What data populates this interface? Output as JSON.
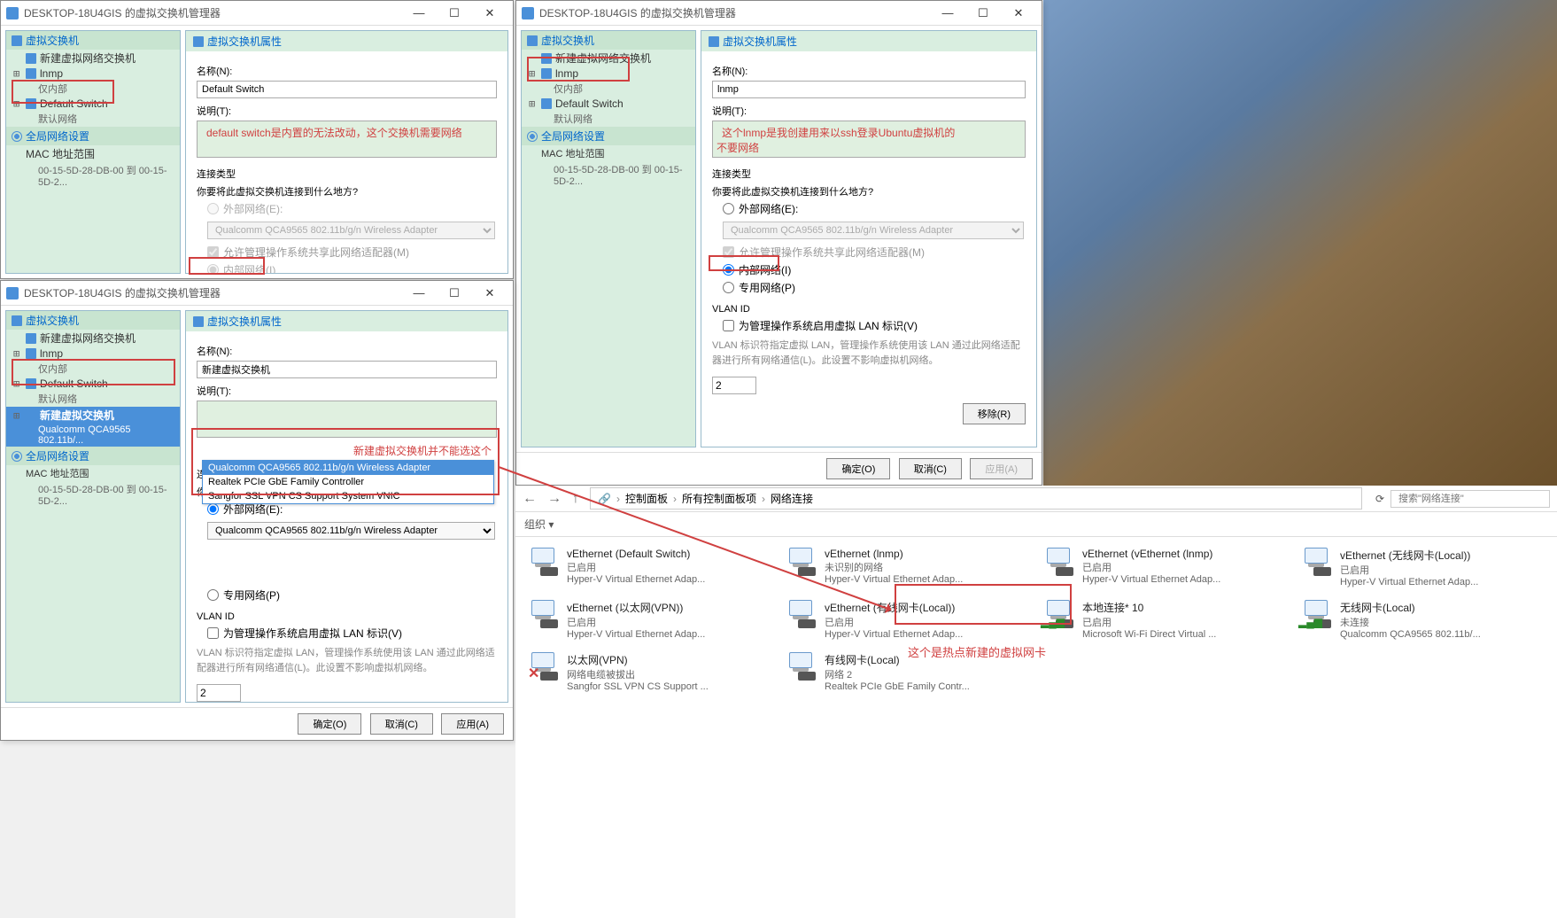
{
  "window_title": "DESKTOP-18U4GIS 的虚拟交换机管理器",
  "tree": {
    "vswitch_header": "虚拟交换机",
    "new_switch": "新建虚拟网络交换机",
    "lnmp": "lnmp",
    "internal_only": "仅内部",
    "default_switch": "Default Switch",
    "default_network": "默认网络",
    "new_vswitch": "新建虚拟交换机",
    "qualcomm_switch": "Qualcomm QCA9565 802.11b/...",
    "global_header": "全局网络设置",
    "mac_range": "MAC 地址范围",
    "mac_value": "00-15-5D-28-DB-00 到 00-15-5D-2..."
  },
  "panels": {
    "header": "虚拟交换机属性",
    "name_label": "名称(N):",
    "desc_label": "说明(T):",
    "conn_title": "连接类型",
    "conn_ask": "你要将此虚拟交换机连接到什么地方?",
    "ext_net": "外部网络(E):",
    "int_net": "内部网络(I)",
    "pri_net": "专用网络(P)",
    "adapter": "Qualcomm QCA9565 802.11b/g/n Wireless Adapter",
    "allow_mgmt": "允许管理操作系统共享此网络适配器(M)",
    "vlan_title": "VLAN ID",
    "vlan_chk": "为管理操作系统启用虚拟 LAN 标识(V)",
    "vlan_hint": "VLAN 标识符指定虚拟 LAN，管理操作系统使用该 LAN 通过此网络适配器进行所有网络通信(L)。此设置不影响虚拟机网络。",
    "vlan_value": "2",
    "remove": "移除(R)",
    "ok": "确定(O)",
    "cancel": "取消(C)",
    "apply": "应用(A)"
  },
  "win1": {
    "name_value": "Default Switch",
    "annotation": "default switch是内置的无法改动，这个交换机需要网络"
  },
  "win2": {
    "name_value": "lnmp",
    "annotation": "这个lnmp是我创建用来以ssh登录Ubuntu虚拟机的\n不要网络"
  },
  "win3": {
    "name_value": "新建虚拟交换机",
    "annotation_top": "新建虚拟交换机并不能选这个",
    "dropdown": {
      "opt0": "Qualcomm QCA9565 802.11b/g/n Wireless Adapter",
      "opt1": "Qualcomm QCA9565 802.11b/g/n Wireless Adapter",
      "opt2": "Realtek PCIe GbE Family Controller",
      "opt3": "Sangfor SSL VPN CS Support System VNIC"
    }
  },
  "explorer": {
    "crumb1": "控制面板",
    "crumb2": "所有控制面板项",
    "crumb3": "网络连接",
    "search_ph": "搜索\"网络连接\"",
    "organize": "组织 ▾",
    "items": [
      {
        "name": "vEthernet (Default Switch)",
        "status": "已启用",
        "desc": "Hyper-V Virtual Ethernet Adap..."
      },
      {
        "name": "vEthernet (lnmp)",
        "status": "未识别的网络",
        "desc": "Hyper-V Virtual Ethernet Adap..."
      },
      {
        "name": "vEthernet (vEthernet (lnmp)",
        "status": "已启用",
        "desc": "Hyper-V Virtual Ethernet Adap..."
      },
      {
        "name": "vEthernet (无线网卡(Local))",
        "status": "已启用",
        "desc": "Hyper-V Virtual Ethernet Adap..."
      },
      {
        "name": "vEthernet (以太网(VPN))",
        "status": "已启用",
        "desc": "Hyper-V Virtual Ethernet Adap..."
      },
      {
        "name": "vEthernet (有线网卡(Local))",
        "status": "已启用",
        "desc": "Hyper-V Virtual Ethernet Adap..."
      },
      {
        "name": "本地连接* 10",
        "status": "已启用",
        "desc": "Microsoft Wi-Fi Direct Virtual ..."
      },
      {
        "name": "无线网卡(Local)",
        "status": "未连接",
        "desc": "Qualcomm QCA9565 802.11b/..."
      },
      {
        "name": "以太网(VPN)",
        "status": "网络电缆被拔出",
        "desc": "Sangfor SSL VPN CS Support ..."
      },
      {
        "name": "有线网卡(Local)",
        "status": "网络 2",
        "desc": "Realtek PCIe GbE Family Contr..."
      }
    ],
    "annotation": "这个是热点新建的虚拟网卡"
  }
}
